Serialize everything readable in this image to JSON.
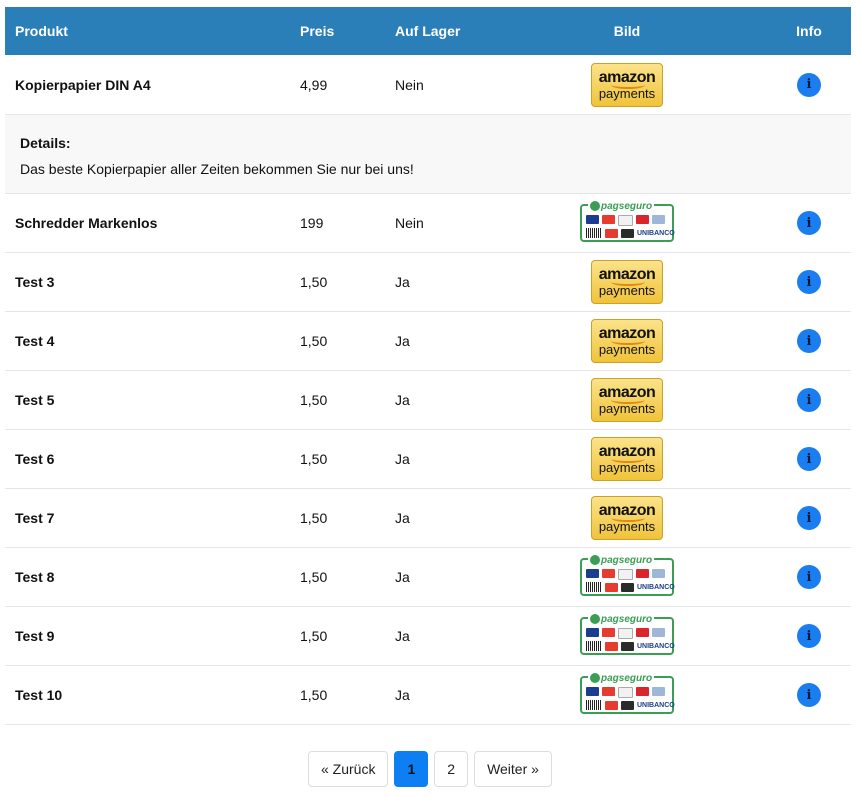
{
  "header": {
    "product": "Produkt",
    "price": "Preis",
    "stock": "Auf Lager",
    "image": "Bild",
    "info": "Info"
  },
  "details": {
    "title": "Details:",
    "text": "Das beste Kopierpapier aller Zeiten bekommen Sie nur bei uns!"
  },
  "rows": [
    {
      "name": "Kopierpapier DIN A4",
      "price": "4,99",
      "stock": "Nein",
      "badge": "amazon-payments",
      "info": "i"
    },
    {
      "name": "Schredder Markenlos",
      "price": "199",
      "stock": "Nein",
      "badge": "pagseguro",
      "info": "i"
    },
    {
      "name": "Test 3",
      "price": "1,50",
      "stock": "Ja",
      "badge": "amazon-payments",
      "info": "i"
    },
    {
      "name": "Test 4",
      "price": "1,50",
      "stock": "Ja",
      "badge": "amazon-payments",
      "info": "i"
    },
    {
      "name": "Test 5",
      "price": "1,50",
      "stock": "Ja",
      "badge": "amazon-payments",
      "info": "i"
    },
    {
      "name": "Test 6",
      "price": "1,50",
      "stock": "Ja",
      "badge": "amazon-payments",
      "info": "i"
    },
    {
      "name": "Test 7",
      "price": "1,50",
      "stock": "Ja",
      "badge": "amazon-payments",
      "info": "i"
    },
    {
      "name": "Test 8",
      "price": "1,50",
      "stock": "Ja",
      "badge": "pagseguro",
      "info": "i"
    },
    {
      "name": "Test 9",
      "price": "1,50",
      "stock": "Ja",
      "badge": "pagseguro",
      "info": "i"
    },
    {
      "name": "Test 10",
      "price": "1,50",
      "stock": "Ja",
      "badge": "pagseguro",
      "info": "i"
    }
  ],
  "badges": {
    "amazon_line1": "amazon",
    "amazon_line2": "payments",
    "pag_logo": "pagseguro",
    "pag_bank": "UNIBANCO"
  },
  "pagination": {
    "prev": "« Zurück",
    "pages": [
      "1",
      "2"
    ],
    "next": "Weiter »",
    "current": "1"
  },
  "colors": {
    "header_bg": "#2a7fb8",
    "info_button": "#1a7ef0",
    "active_page": "#0d7ff2",
    "details_bg": "#f8f8f8"
  }
}
